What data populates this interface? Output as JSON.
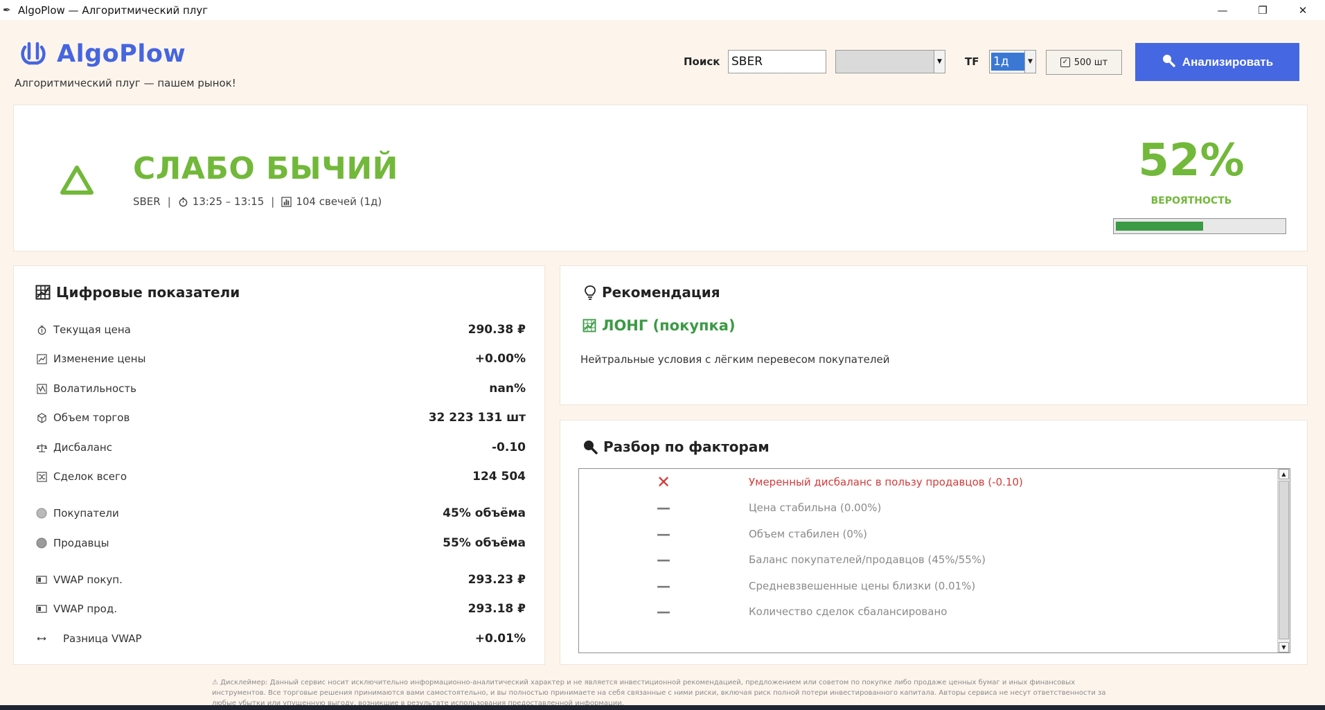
{
  "window": {
    "title": "AlgoPlow — Алгоритмический плуг",
    "controls": {
      "minimize": "—",
      "maximize": "❐",
      "close": "✕"
    }
  },
  "brand": {
    "name": "AlgoPlow",
    "tagline": "Алгоритмический плуг — пашем рынок!",
    "logo_icon": "plow-logo-icon",
    "color": "#4665df"
  },
  "toolbar": {
    "search_label": "Поиск",
    "search_value": "SBER",
    "combo_value": "",
    "tf_label": "TF",
    "tf_value": "1д",
    "count_label": "500 шт",
    "count_checked": true,
    "analyze_label": "Анализировать",
    "analyze_icon": "magnifier-icon",
    "analyze_color": "#4567e2"
  },
  "signal": {
    "title": "СЛАБО БЫЧИЙ",
    "ticker": "SBER",
    "time_range": "13:25 – 13:15",
    "candles": "104 свечей (1д)",
    "probability": "52%",
    "probability_fraction": 0.52,
    "probability_label": "ВЕРОЯТНОСТЬ",
    "color": "#72b83a",
    "bar_color": "#3b9a45"
  },
  "metrics": {
    "title": "Цифровые показатели",
    "rows": [
      {
        "label": "Текущая цена",
        "value": "290.38 ₽",
        "icon": "price-icon"
      },
      {
        "label": "Изменение цены",
        "value": "+0.00%",
        "icon": "chart-change-icon"
      },
      {
        "label": "Волатильность",
        "value": "nan%",
        "icon": "volatility-icon"
      },
      {
        "label": "Объем торгов",
        "value": "32 223 131 шт",
        "icon": "cube-icon"
      },
      {
        "label": "Дисбаланс",
        "value": "-0.10",
        "icon": "scales-icon"
      },
      {
        "label": "Сделок всего",
        "value": "124 504",
        "icon": "shuffle-icon"
      },
      {
        "label": "Покупатели",
        "value": "45% объёма",
        "icon": "buyers-dot-icon"
      },
      {
        "label": "Продавцы",
        "value": "55% объёма",
        "icon": "sellers-dot-icon"
      },
      {
        "label": "VWAP покуп.",
        "value": "293.23 ₽",
        "icon": "vwap-buy-icon"
      },
      {
        "label": "VWAP прод.",
        "value": "293.18 ₽",
        "icon": "vwap-sell-icon"
      },
      {
        "label": "Разница VWAP",
        "value": "+0.01%",
        "icon": "arrows-left-right-icon"
      }
    ]
  },
  "recommendation": {
    "title": "Рекомендация",
    "action": "ЛОНГ (покупка)",
    "description": "Нейтральные условия с лёгким перевесом покупателей",
    "color": "#3b9a45"
  },
  "factors": {
    "title": "Разбор по факторам",
    "rows": [
      {
        "mark": "✕",
        "text": "Умеренный дисбаланс в пользу продавцов (-0.10)",
        "kind": "negative",
        "color": "#d43a3a"
      },
      {
        "mark": "—",
        "text": "Цена стабильна (0.00%)",
        "kind": "neutral",
        "color": "#8a8a8a"
      },
      {
        "mark": "—",
        "text": "Объем стабилен (0%)",
        "kind": "neutral",
        "color": "#8a8a8a"
      },
      {
        "mark": "—",
        "text": "Баланс покупателей/продавцов (45%/55%)",
        "kind": "neutral",
        "color": "#8a8a8a"
      },
      {
        "mark": "—",
        "text": "Средневзвешенные цены близки (0.01%)",
        "kind": "neutral",
        "color": "#8a8a8a"
      },
      {
        "mark": "—",
        "text": "Количество сделок сбалансировано",
        "kind": "neutral",
        "color": "#8a8a8a"
      }
    ]
  },
  "disclaimer": "⚠ Дисклеймер: Данный сервис носит исключительно информационно-аналитический характер и не является инвестиционной рекомендацией, предложением или советом по покупке либо продаже ценных бумаг и иных финансовых инструментов. Все торговые решения принимаются вами самостоятельно, и вы полностью принимаете на себя связанные с ними риски, включая риск полной потери инвестированного капитала. Авторы сервиса не несут ответственности за любые убытки или упущенную выгоду, возникшие в результате использования предоставленной информации."
}
